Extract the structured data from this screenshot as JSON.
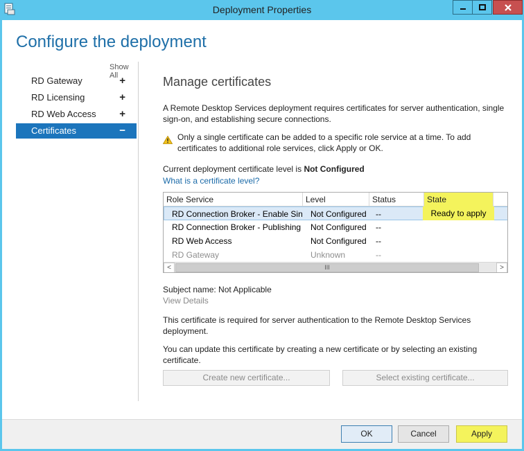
{
  "window": {
    "title": "Deployment Properties"
  },
  "heading": "Configure the deployment",
  "sidebar": {
    "show_all": "Show All",
    "items": [
      {
        "label": "RD Gateway",
        "sign": "+"
      },
      {
        "label": "RD Licensing",
        "sign": "+"
      },
      {
        "label": "RD Web Access",
        "sign": "+"
      },
      {
        "label": "Certificates",
        "sign": "−"
      }
    ]
  },
  "main": {
    "title": "Manage certificates",
    "description": "A Remote Desktop Services deployment requires certificates for server authentication, single sign-on, and establishing secure connections.",
    "warning": "Only a single certificate can be added to a specific role service at a time. To add certificates to additional role services, click Apply or OK.",
    "level_prefix": "Current deployment certificate level is",
    "level_value": "Not Configured",
    "level_link": "What is a certificate level?",
    "table": {
      "columns": [
        "Role Service",
        "Level",
        "Status",
        "State"
      ],
      "rows": [
        {
          "role": "RD Connection Broker - Enable Single Sign On",
          "level": "Not Configured",
          "status": "--",
          "state": "Ready to apply"
        },
        {
          "role": "RD Connection Broker - Publishing",
          "level": "Not Configured",
          "status": "--",
          "state": ""
        },
        {
          "role": "RD Web Access",
          "level": "Not Configured",
          "status": "--",
          "state": ""
        },
        {
          "role": "RD Gateway",
          "level": "Unknown",
          "status": "--",
          "state": ""
        }
      ],
      "scroll_left": "<",
      "scroll_right": ">",
      "scroll_grip": "III"
    },
    "subject_name": "Subject name: Not Applicable",
    "view_details": "View Details",
    "para1": "This certificate is required for server authentication to the Remote Desktop Services deployment.",
    "para2": "You can update this certificate by creating a new certificate or by selecting an existing certificate.",
    "create_button": "Create new certificate...",
    "select_button": "Select existing certificate..."
  },
  "footer": {
    "ok": "OK",
    "cancel": "Cancel",
    "apply": "Apply"
  },
  "colors": {
    "titlebar": "#5bc6ec",
    "accent": "#1c75bc",
    "highlight": "#f4f35c"
  }
}
